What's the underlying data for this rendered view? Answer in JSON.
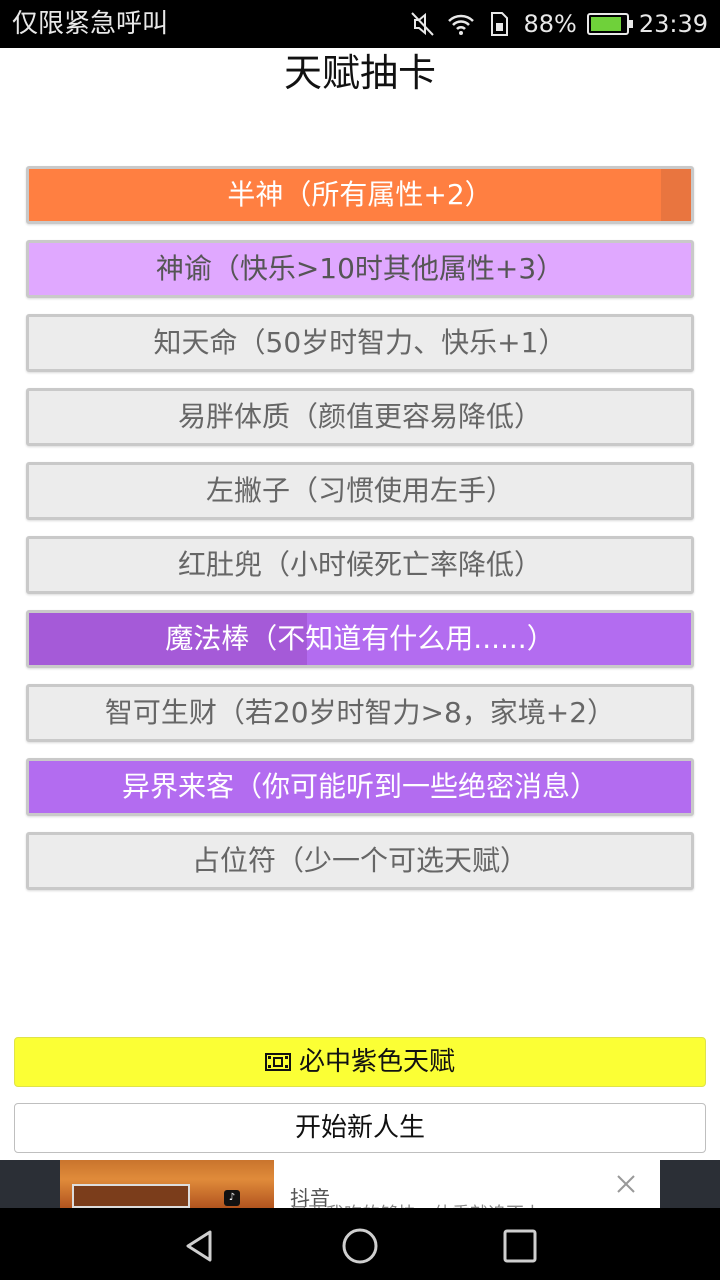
{
  "status": {
    "carrier": "仅限紧急呼叫",
    "battery": "88%",
    "time": "23:39",
    "icons": [
      "mute-icon",
      "wifi-icon",
      "sim-icon",
      "battery-icon"
    ]
  },
  "header": {
    "title": "天赋抽卡"
  },
  "talents": [
    {
      "label": "半神（所有属性+2）",
      "tier": "gold"
    },
    {
      "label": "神谕（快乐>10时其他属性+3）",
      "tier": "pink"
    },
    {
      "label": "知天命（50岁时智力、快乐+1）",
      "tier": "common"
    },
    {
      "label": "易胖体质（颜值更容易降低）",
      "tier": "common"
    },
    {
      "label": "左撇子（习惯使用左手）",
      "tier": "common"
    },
    {
      "label": "红肚兜（小时候死亡率降低）",
      "tier": "common"
    },
    {
      "label": "魔法棒（不知道有什么用......）",
      "tier": "purple"
    },
    {
      "label": "智可生财（若20岁时智力>8，家境+2）",
      "tier": "common"
    },
    {
      "label": "异界来客（你可能听到一些绝密消息）",
      "tier": "purple"
    },
    {
      "label": "占位符（少一个可选天赋）",
      "tier": "common"
    }
  ],
  "actions": {
    "purple_label": "必中紫色天赋",
    "purple_icon": "video-icon",
    "new_life_label": "开始新人生"
  },
  "ad": {
    "name": "抖音",
    "description": "只要我吃的够快，体重就追不上"
  },
  "colors": {
    "gold": "#ff7f41",
    "pink": "#e0a8ff",
    "purple": "#b36cf0",
    "common": "#ececec",
    "yellow_button": "#fbff35"
  }
}
